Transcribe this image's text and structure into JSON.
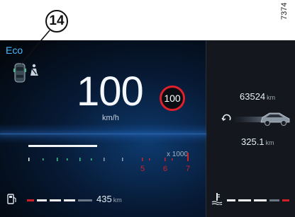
{
  "callout": {
    "number": "14"
  },
  "reference_code": "7374",
  "cluster": {
    "drive_mode": "Eco",
    "speed": "100",
    "speed_unit": "km/h",
    "speed_limit": "100",
    "rpm_multiplier": "x 1000",
    "rpm_labels": [
      "5",
      "6",
      "7"
    ],
    "odometer": {
      "value": "63524",
      "unit": "km"
    },
    "trip": {
      "value": "325.1",
      "unit": "km"
    },
    "fuel_range": {
      "value": "435",
      "unit": "km"
    },
    "colors": {
      "mode_accent": "#47b9ff",
      "redline": "#d0202a",
      "limit_ring": "#e0202c",
      "eco_green": "#3ec28f"
    }
  }
}
